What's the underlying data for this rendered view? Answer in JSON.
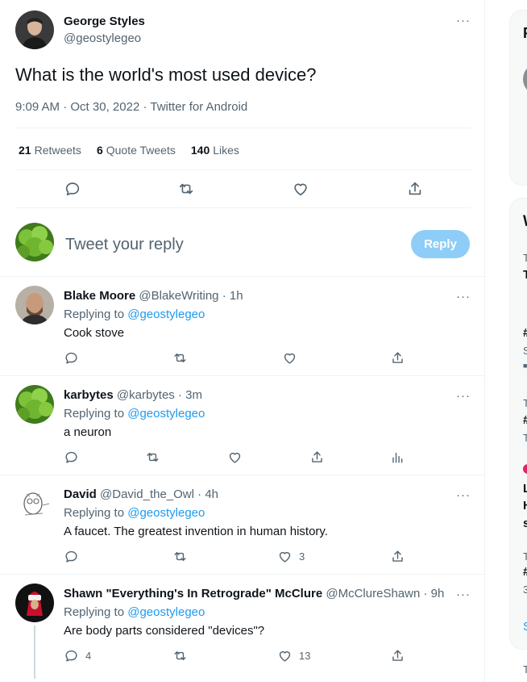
{
  "main_tweet": {
    "author_name": "George Styles",
    "author_handle": "@geostylegeo",
    "text": "What is the world's most used device?",
    "time": "9:09 AM",
    "date": "Oct 30, 2022",
    "source": "Twitter for Android",
    "sep": "·",
    "more": "···",
    "stats": {
      "retweets_count": "21",
      "retweets_label": "Retweets",
      "quotes_count": "6",
      "quotes_label": "Quote Tweets",
      "likes_count": "140",
      "likes_label": "Likes"
    }
  },
  "composer": {
    "placeholder": "Tweet your reply",
    "button_label": "Reply"
  },
  "replies": [
    {
      "name": "Blake Moore",
      "handle": "@BlakeWriting",
      "time": "1h",
      "replying_prefix": "Replying to",
      "replying_handle": "@geostylegeo",
      "text": "Cook stove",
      "reply_count": "",
      "like_count": "",
      "avatar": "bald-man"
    },
    {
      "name": "karbytes",
      "handle": "@karbytes",
      "time": "3m",
      "replying_prefix": "Replying to",
      "replying_handle": "@geostylegeo",
      "text": "a neuron",
      "reply_count": "",
      "like_count": "",
      "avatar": "green-plant"
    },
    {
      "name": "David",
      "handle": "@David_the_Owl",
      "time": "4h",
      "replying_prefix": "Replying to",
      "replying_handle": "@geostylegeo",
      "text": "A faucet. The greatest invention in human history.",
      "reply_count": "",
      "like_count": "3",
      "avatar": "owl-sketch"
    },
    {
      "name": "Shawn \"Everything's In Retrograde\" McClure",
      "handle": "@McClureShawn",
      "time": "9h",
      "replying_prefix": "Replying to",
      "replying_handle": "@geostylegeo",
      "text": "Are body parts considered \"devices\"?",
      "reply_count": "4",
      "like_count": "13",
      "avatar": "hooded-figure"
    }
  ],
  "right_column": {
    "items": [
      "F",
      "W",
      "T",
      "T",
      "#",
      "S",
      "■",
      "T",
      "#",
      "T",
      "L",
      "H",
      "s",
      "T",
      "#",
      "3",
      "S",
      "T"
    ]
  },
  "colors": {
    "accent": "#1d9bf0",
    "reply_button": "#8ecdf8",
    "secondary_text": "#536471",
    "divider": "#eff3f4"
  }
}
